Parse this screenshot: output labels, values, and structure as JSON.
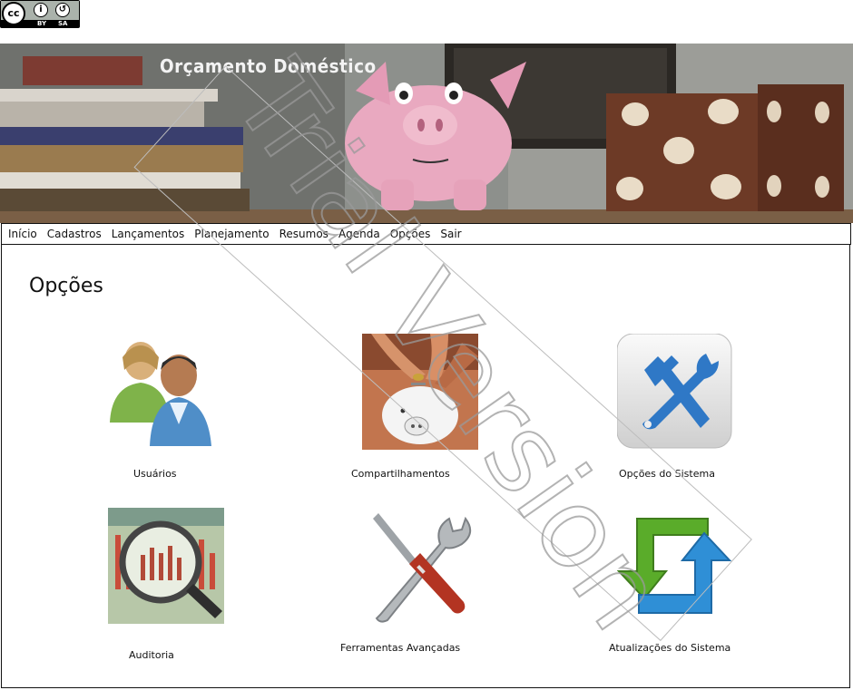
{
  "license_badge": {
    "main": "cc",
    "labels": [
      "BY",
      "SA"
    ]
  },
  "banner": {
    "title": "Orçamento Doméstico"
  },
  "menu": {
    "items": [
      "Início",
      "Cadastros",
      "Lançamentos",
      "Planejamento",
      "Resumos",
      "Agenda",
      "Opções",
      "Sair"
    ]
  },
  "page": {
    "title": "Opções"
  },
  "options": [
    {
      "label": "Usuários",
      "icon": "users-icon"
    },
    {
      "label": "Compartilhamentos",
      "icon": "piggy-bank-coins-icon"
    },
    {
      "label": "Opções do Sistema",
      "icon": "wrench-hammer-icon"
    },
    {
      "label": "Auditoria",
      "icon": "magnifier-chart-icon"
    },
    {
      "label": "Ferramentas Avançadas",
      "icon": "screwdriver-wrench-icon"
    },
    {
      "label": "Atualizações do Sistema",
      "icon": "update-arrows-icon"
    }
  ],
  "watermark": {
    "text": "Trial Version"
  },
  "colors": {
    "menu_border": "#111111",
    "piggy_pink": "#e8a6bf",
    "accent_blue": "#2f78c6",
    "accent_green": "#5aac2a"
  }
}
